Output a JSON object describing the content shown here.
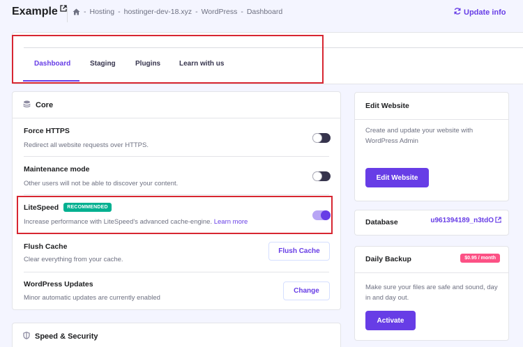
{
  "header": {
    "site_title": "Example",
    "breadcrumb": [
      "Hosting",
      "hostinger-dev-18.xyz",
      "WordPress",
      "Dashboard"
    ],
    "separator": "-",
    "update_label": "Update info"
  },
  "tabs": [
    {
      "label": "Dashboard",
      "active": true
    },
    {
      "label": "Staging",
      "active": false
    },
    {
      "label": "Plugins",
      "active": false
    },
    {
      "label": "Learn with us",
      "active": false
    }
  ],
  "core": {
    "title": "Core",
    "rows": [
      {
        "title": "Force HTTPS",
        "desc": "Redirect all website requests over HTTPS.",
        "toggle": "off"
      },
      {
        "title": "Maintenance mode",
        "desc": "Other users will not be able to discover your content.",
        "toggle": "off"
      },
      {
        "title": "LiteSpeed",
        "badge": "RECOMMENDED",
        "desc": "Increase performance with LiteSpeed's advanced cache-engine.",
        "link": "Learn more",
        "toggle": "on"
      },
      {
        "title": "Flush Cache",
        "desc": "Clear everything from your cache.",
        "button": "Flush Cache"
      },
      {
        "title": "WordPress Updates",
        "desc": "Minor automatic updates are currently enabled",
        "button": "Change"
      }
    ]
  },
  "speed_security": {
    "title": "Speed & Security"
  },
  "edit_website": {
    "title": "Edit Website",
    "desc": "Create and update your website with WordPress Admin",
    "button": "Edit Website"
  },
  "database": {
    "label": "Database",
    "name": "u961394189_n3tdO"
  },
  "daily_backup": {
    "title": "Daily Backup",
    "price": "$0.95 / month",
    "desc": "Make sure your files are safe and sound, day in and day out.",
    "button": "Activate"
  },
  "colors": {
    "accent": "#673de6",
    "highlight": "#d72631",
    "recommended": "#00b090",
    "price_badge": "#fc5185"
  }
}
